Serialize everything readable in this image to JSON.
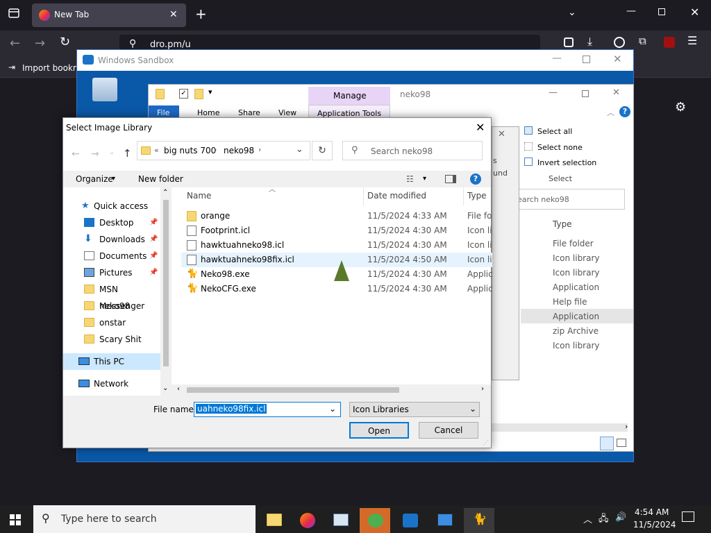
{
  "firefox": {
    "tab_title": "New Tab",
    "url": "dro.pm/u",
    "bookmark_import": "Import bookm"
  },
  "sandbox": {
    "title": "Windows Sandbox"
  },
  "explorer": {
    "tabs": [
      "File",
      "Home",
      "Share",
      "View",
      "Application Tools"
    ],
    "manage_label": "Manage",
    "window_title": "neko98",
    "menu_initial": "M",
    "ribbon_select": [
      "Select all",
      "Select none",
      "Invert selection"
    ],
    "ribbon_group": "Select",
    "search_placeholder": "earch neko98",
    "col_type": "Type",
    "types": [
      "File folder",
      "Icon library",
      "Icon library",
      "Application",
      "Help file",
      "Application",
      "zip Archive",
      "Icon library"
    ],
    "partial_labels": [
      "s",
      "und"
    ]
  },
  "dialog": {
    "title": "Select Image Library",
    "path": [
      "big nuts 700",
      "neko98"
    ],
    "path_prefix": "«",
    "search_placeholder": "Search neko98",
    "organize": "Organize",
    "new_folder": "New folder",
    "nav": [
      {
        "label": "Quick access",
        "icon": "star-icon"
      },
      {
        "label": "Desktop",
        "icon": "desktop-icon",
        "pinned": true
      },
      {
        "label": "Downloads",
        "icon": "download-icon",
        "pinned": true
      },
      {
        "label": "Documents",
        "icon": "documents-icon",
        "pinned": true
      },
      {
        "label": "Pictures",
        "icon": "pictures-icon",
        "pinned": true
      },
      {
        "label": "MSN Messenger",
        "icon": "folder-icon"
      },
      {
        "label": "neko98",
        "icon": "folder-icon"
      },
      {
        "label": "onstar",
        "icon": "folder-icon"
      },
      {
        "label": "Scary Shit",
        "icon": "folder-icon"
      },
      {
        "label": "This PC",
        "icon": "pc-icon"
      },
      {
        "label": "Network",
        "icon": "network-icon"
      }
    ],
    "columns": {
      "name": "Name",
      "date": "Date modified",
      "type": "Type"
    },
    "files": [
      {
        "name": "orange",
        "date": "11/5/2024 4:33 AM",
        "type": "File fol",
        "kind": "folder"
      },
      {
        "name": "Footprint.icl",
        "date": "11/5/2024 4:30 AM",
        "type": "Icon lil",
        "kind": "file"
      },
      {
        "name": "hawktuahneko98.icl",
        "date": "11/5/2024 4:30 AM",
        "type": "Icon lil",
        "kind": "file"
      },
      {
        "name": "hawktuahneko98fix.icl",
        "date": "11/5/2024 4:50 AM",
        "type": "Icon lil",
        "kind": "file"
      },
      {
        "name": "Neko98.exe",
        "date": "11/5/2024 4:30 AM",
        "type": "Applic",
        "kind": "exe"
      },
      {
        "name": "NekoCFG.exe",
        "date": "11/5/2024 4:30 AM",
        "type": "Applic",
        "kind": "exe"
      }
    ],
    "file_name_label": "File name:",
    "file_name_value": "uahneko98fix.icl",
    "filter": "Icon Libraries",
    "open": "Open",
    "cancel": "Cancel"
  },
  "taskbar": {
    "search_placeholder": "Type here to search",
    "time": "4:54 AM",
    "date": "11/5/2024"
  },
  "colors": {
    "accent": "#0078d7",
    "selection": "#cce8ff",
    "firefox_bg": "#1c1b22"
  }
}
